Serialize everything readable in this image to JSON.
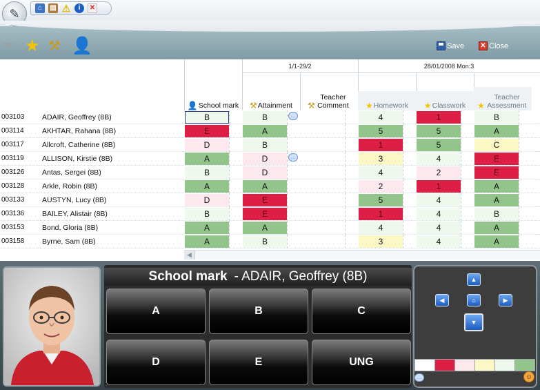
{
  "toolbar": {
    "save_label": "Save",
    "close_label": "Close"
  },
  "grid": {
    "period_1": "1/1-29/2",
    "period_2": "28/01/2008 Mon:3",
    "columns": [
      {
        "label": "School mark",
        "icon": "teacher-icon"
      },
      {
        "label": "Attainment",
        "icon": "tools-icon"
      },
      {
        "label": "Teacher Comment",
        "icon": "tools-icon"
      },
      {
        "label": "Homework",
        "icon": "star-icon"
      },
      {
        "label": "Classwork",
        "icon": "star-icon"
      },
      {
        "label": "Teacher Assessment",
        "icon": "star-icon"
      }
    ],
    "students": [
      {
        "upn": "003103",
        "name": "ADAIR, Geoffrey (8B)",
        "school": "B",
        "att": "B",
        "comment": true,
        "hw": "4",
        "cw": "1",
        "ta": "B"
      },
      {
        "upn": "003114",
        "name": "AKHTAR, Rahana (8B)",
        "school": "E",
        "att": "A",
        "comment": false,
        "hw": "5",
        "cw": "5",
        "ta": "A"
      },
      {
        "upn": "003117",
        "name": "Allcroft, Catherine (8B)",
        "school": "D",
        "att": "B",
        "comment": false,
        "hw": "1",
        "cw": "5",
        "ta": "C"
      },
      {
        "upn": "003119",
        "name": "ALLISON, Kirstie (8B)",
        "school": "A",
        "att": "D",
        "comment": true,
        "hw": "3",
        "cw": "4",
        "ta": "E"
      },
      {
        "upn": "003126",
        "name": "Antas, Sergei (8B)",
        "school": "B",
        "att": "D",
        "comment": false,
        "hw": "4",
        "cw": "2",
        "ta": "E"
      },
      {
        "upn": "003128",
        "name": "Arkle, Robin (8B)",
        "school": "A",
        "att": "A",
        "comment": false,
        "hw": "2",
        "cw": "1",
        "ta": "A"
      },
      {
        "upn": "003133",
        "name": "AUSTYN, Lucy (8B)",
        "school": "D",
        "att": "E",
        "comment": false,
        "hw": "5",
        "cw": "4",
        "ta": "A"
      },
      {
        "upn": "003136",
        "name": "BAILEY, Alistair (8B)",
        "school": "B",
        "att": "E",
        "comment": false,
        "hw": "1",
        "cw": "4",
        "ta": "B"
      },
      {
        "upn": "003153",
        "name": "Bond, Gloria (8B)",
        "school": "A",
        "att": "A",
        "comment": false,
        "hw": "4",
        "cw": "4",
        "ta": "A"
      },
      {
        "upn": "003158",
        "name": "Byrne, Sam (8B)",
        "school": "A",
        "att": "B",
        "comment": false,
        "hw": "3",
        "cw": "4",
        "ta": "A"
      }
    ]
  },
  "colors": {
    "A": "#93c48c",
    "B": "#eef8ec",
    "C": "#fbf8c6",
    "D": "#fde8ee",
    "E": "#dd1f46",
    "1": "#dd1f46",
    "2": "#fde8ee",
    "3": "#fbf8c6",
    "4": "#eef8ec",
    "5": "#93c48c"
  },
  "entry": {
    "title_label": "School mark",
    "title_student": "- ADAIR, Geoffrey (8B)",
    "buttons": [
      "A",
      "B",
      "C",
      "D",
      "E",
      "UNG"
    ]
  },
  "legend": {
    "swatches": [
      "#ffffff",
      "#dd1f46",
      "#fde8ee",
      "#fbf8c6",
      "#eef8ec",
      "#93c48c"
    ]
  }
}
